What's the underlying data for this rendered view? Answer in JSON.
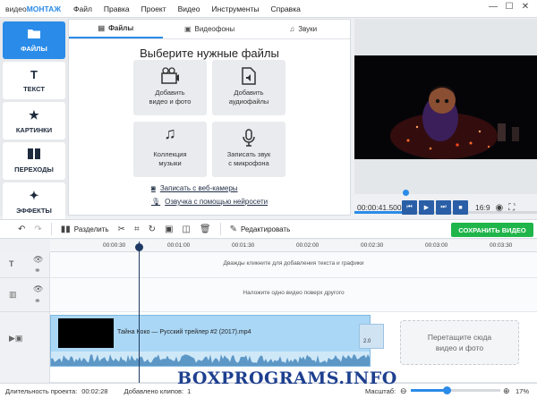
{
  "app": {
    "brand_prefix": "видео",
    "brand_suffix": "МОНТАЖ",
    "menu": [
      "Файл",
      "Правка",
      "Проект",
      "Видео",
      "Инструменты",
      "Справка"
    ],
    "window_controls": [
      "—",
      "☐",
      "✕"
    ]
  },
  "sidebar": {
    "items": [
      {
        "label": "ФАЙЛЫ",
        "icon": "folder-icon",
        "active": true
      },
      {
        "label": "ТЕКСТ",
        "icon": "text-icon",
        "active": false
      },
      {
        "label": "КАРТИНКИ",
        "icon": "star-icon",
        "active": false
      },
      {
        "label": "ПЕРЕХОДЫ",
        "icon": "transition-icon",
        "active": false
      },
      {
        "label": "ЭФФЕКТЫ",
        "icon": "magic-wand-icon",
        "active": false
      }
    ]
  },
  "files_panel": {
    "tabs": [
      {
        "label": "Файлы",
        "icon": "file-icon",
        "active": true
      },
      {
        "label": "Видеофоны",
        "icon": "film-icon",
        "active": false
      },
      {
        "label": "Звуки",
        "icon": "music-icon",
        "active": false
      }
    ],
    "heading": "Выберите нужные файлы",
    "tiles": [
      {
        "line1": "Добавить",
        "line2": "видео и фото",
        "icon": "film-reel-icon"
      },
      {
        "line1": "Добавить",
        "line2": "аудиофайлы",
        "icon": "audio-file-icon"
      },
      {
        "line1": "Коллекция",
        "line2": "музыки",
        "icon": "music-note-icon"
      },
      {
        "line1": "Записать звук",
        "line2": "с микрофона",
        "icon": "microphone-icon"
      }
    ],
    "links": [
      {
        "label": "Записать с веб-камеры",
        "icon": "webcam-icon"
      },
      {
        "label": "Озвучка с помощью нейросети",
        "icon": "microphone-icon"
      }
    ]
  },
  "preview": {
    "timecode": "00:00:41.500",
    "aspect_ratio": "16:9",
    "progress": 0.28,
    "controls": [
      "prev-icon",
      "play-icon",
      "next-icon",
      "stop-icon"
    ]
  },
  "toolbar": {
    "split_label": "Разделить",
    "edit_label": "Редактировать",
    "save_label": "СОХРАНИТЬ ВИДЕО"
  },
  "timeline": {
    "ruler_labels": [
      "00:00:30",
      "00:01:00",
      "00:01:30",
      "00:02:00",
      "00:02:30",
      "00:03:00",
      "00:03:30"
    ],
    "text_track_hint": "Дважды кликните для добавления текста и графики",
    "overlay_track_hint": "Наложите одно видео поверх другого",
    "clip_title": "Тайна Коко — Русский трейлер #2 (2017).mp4",
    "clip_badge": "2.0",
    "dropzone_line1": "Перетащите сюда",
    "dropzone_line2": "видео и фото"
  },
  "status": {
    "duration_label": "Длительность проекта:",
    "duration_value": "00:02:28",
    "clips_label": "Добавлено клипов:",
    "clips_value": "1",
    "zoom_label": "Масштаб:",
    "zoom_value": "17%",
    "zoom_level": 0.4
  },
  "watermark": "BOXPROGRAMS.INFO",
  "colors": {
    "accent": "#2a8be8",
    "save": "#1fb54a",
    "clip": "#aad7f5",
    "navy": "#1e3a63"
  }
}
